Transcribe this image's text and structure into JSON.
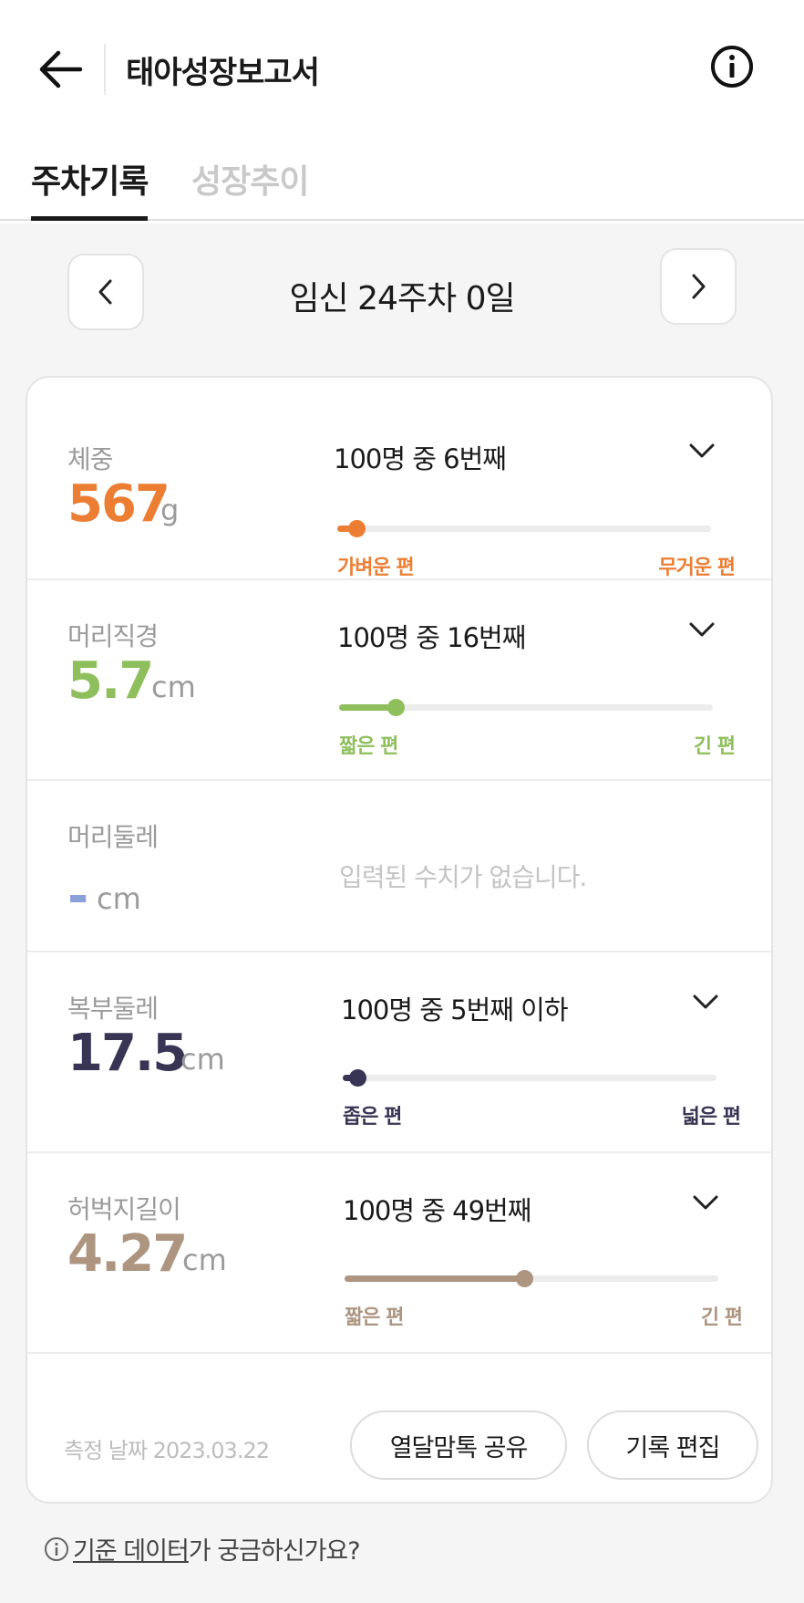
{
  "header": {
    "title": "태아성장보고서",
    "back_icon": "arrow-left-icon",
    "info_icon": "info-circle-icon"
  },
  "tabs": [
    {
      "label": "주차기록",
      "active": true
    },
    {
      "label": "성장추이",
      "active": false
    }
  ],
  "week_nav": {
    "label": "임신 24주차 0일"
  },
  "colors": {
    "weight": "#ec7e34",
    "head_diameter": "#8ebf5c",
    "head_circumference": "#8aa0d8",
    "abdomen": "#383454",
    "femur": "#ad9580"
  },
  "measurements": [
    {
      "label": "체중",
      "value": "567",
      "unit": "g",
      "rank": "100명 중 6번째",
      "percentile": 0.05,
      "left_label": "가벼운 편",
      "right_label": "무거운 편"
    },
    {
      "label": "머리직경",
      "value": "5.7",
      "unit": "cm",
      "rank": "100명 중 16번째",
      "percentile": 0.15,
      "left_label": "짧은 편",
      "right_label": "긴 편"
    },
    {
      "label": "머리둘레",
      "value": "-",
      "unit": "cm",
      "empty_text": "입력된 수치가 없습니다."
    },
    {
      "label": "복부둘레",
      "value": "17.5",
      "unit": "cm",
      "rank": "100명 중 5번째 이하",
      "percentile": 0.04,
      "left_label": "좁은 편",
      "right_label": "넓은 편"
    },
    {
      "label": "허벅지길이",
      "value": "4.27",
      "unit": "cm",
      "rank": "100명 중 49번째",
      "percentile": 0.48,
      "left_label": "짧은 편",
      "right_label": "긴 편"
    }
  ],
  "footer": {
    "date_text": "측정 날짜 2023.03.22",
    "share_button": "열달맘톡 공유",
    "edit_button": "기록 편집"
  },
  "help": {
    "link_text": "기준 데이터",
    "rest_text": "가 궁금하신가요?"
  }
}
